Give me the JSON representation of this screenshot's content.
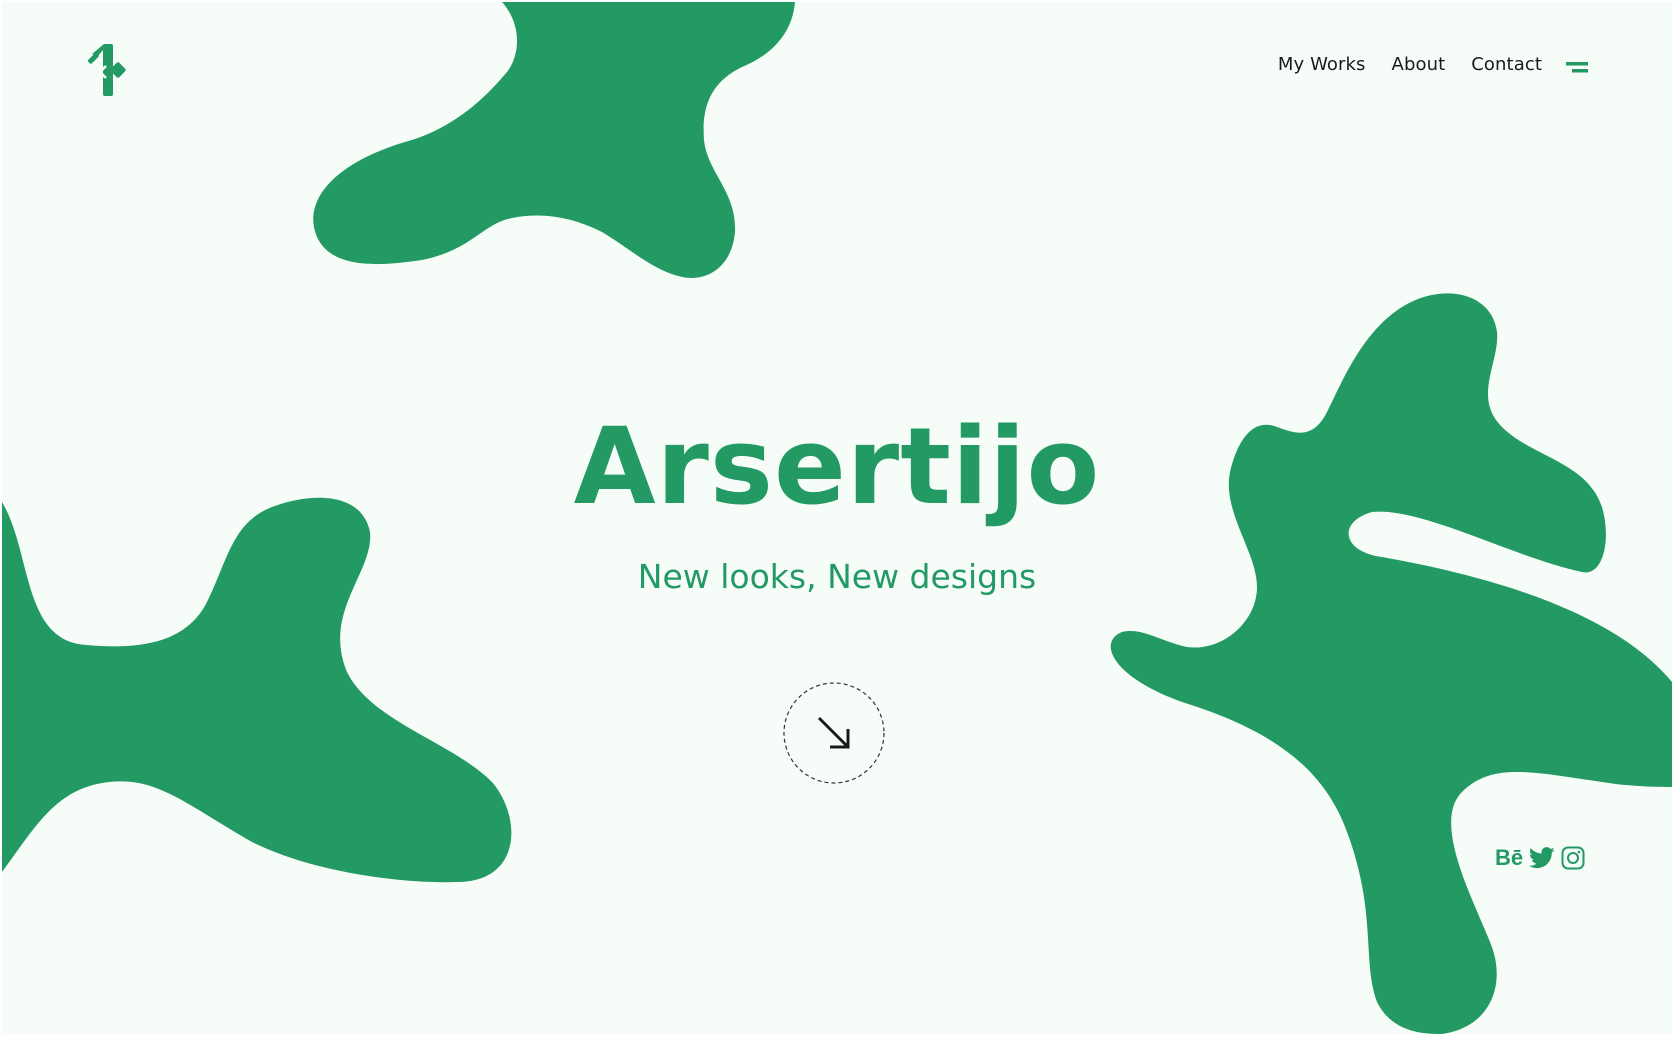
{
  "brand": {
    "accent": "#239a64",
    "background": "#f6fdf9",
    "logo_icon": "brand-logo-icon"
  },
  "nav": {
    "items": [
      {
        "label": "My Works"
      },
      {
        "label": "About"
      },
      {
        "label": "Contact"
      }
    ],
    "menu_icon": "menu-icon"
  },
  "hero": {
    "title": "Arsertijo",
    "subtitle": "New looks, New designs",
    "scroll_icon": "arrow-down-right-icon"
  },
  "socials": {
    "behance_label": "Bē",
    "twitter_icon": "twitter-icon",
    "instagram_icon": "instagram-icon"
  }
}
